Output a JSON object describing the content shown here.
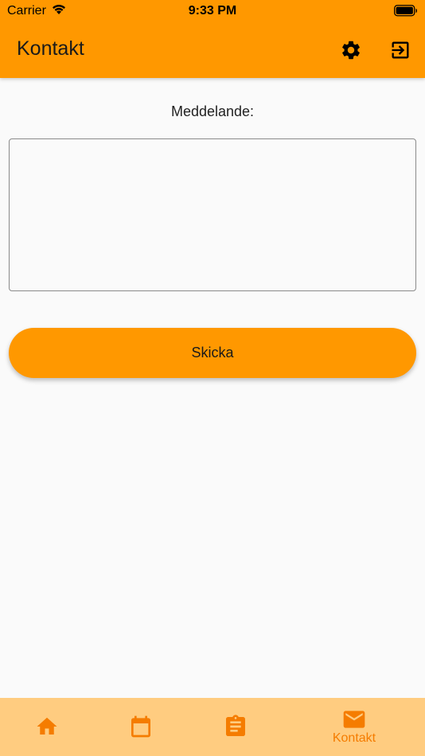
{
  "status_bar": {
    "carrier": "Carrier",
    "time": "9:33 PM"
  },
  "app_bar": {
    "title": "Kontakt",
    "actions": [
      {
        "icon": "gear-icon"
      },
      {
        "icon": "logout-icon"
      }
    ]
  },
  "form": {
    "message_label": "Meddelande:",
    "message_value": "",
    "send_label": "Skicka"
  },
  "bottom_nav": {
    "items": [
      {
        "icon": "home-icon",
        "label": "",
        "active": false
      },
      {
        "icon": "calendar-icon",
        "label": "",
        "active": false
      },
      {
        "icon": "clipboard-icon",
        "label": "",
        "active": false
      },
      {
        "icon": "mail-icon",
        "label": "Kontakt",
        "active": true
      }
    ]
  },
  "colors": {
    "primary": "#ff9800",
    "nav_background": "#ffcc80",
    "nav_active": "#f57c00",
    "background": "#fafafa"
  }
}
